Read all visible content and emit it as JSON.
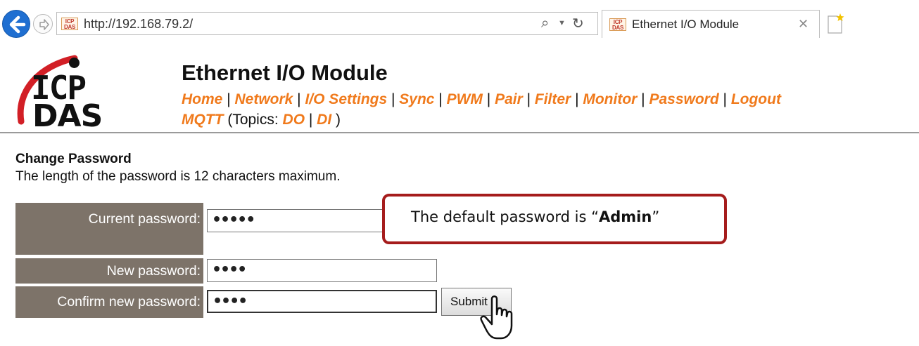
{
  "browser": {
    "url": "http://192.168.79.2/",
    "tab_title": "Ethernet I/O Module",
    "favicon_text": "ICP DAS"
  },
  "header": {
    "logo_line1": "ICP",
    "logo_line2": "DAS",
    "title": "Ethernet I/O Module",
    "menu": [
      "Home",
      "Network",
      "I/O Settings",
      "Sync",
      "PWM",
      "Pair",
      "Filter",
      "Monitor",
      "Password",
      "Logout"
    ],
    "mqtt_label": "MQTT",
    "topics_prefix": "(Topics:",
    "topics": [
      "DO",
      "DI"
    ],
    "topics_suffix": ")"
  },
  "content": {
    "heading": "Change Password",
    "description": "The length of the password is 12 characters maximum.",
    "current_label": "Current password:",
    "current_value": "•••••",
    "new_label": "New password:",
    "new_value": "••••",
    "confirm_label": "Confirm new password:",
    "confirm_value": "••••",
    "submit_label": "Submit"
  },
  "callout": {
    "prefix": "The default password is “",
    "emphasis": "Admin",
    "suffix": "”"
  },
  "colors": {
    "link": "#f07a1c",
    "label_bg": "#7d7369",
    "callout_border": "#a51c1c",
    "back_button": "#1f6fd1"
  }
}
